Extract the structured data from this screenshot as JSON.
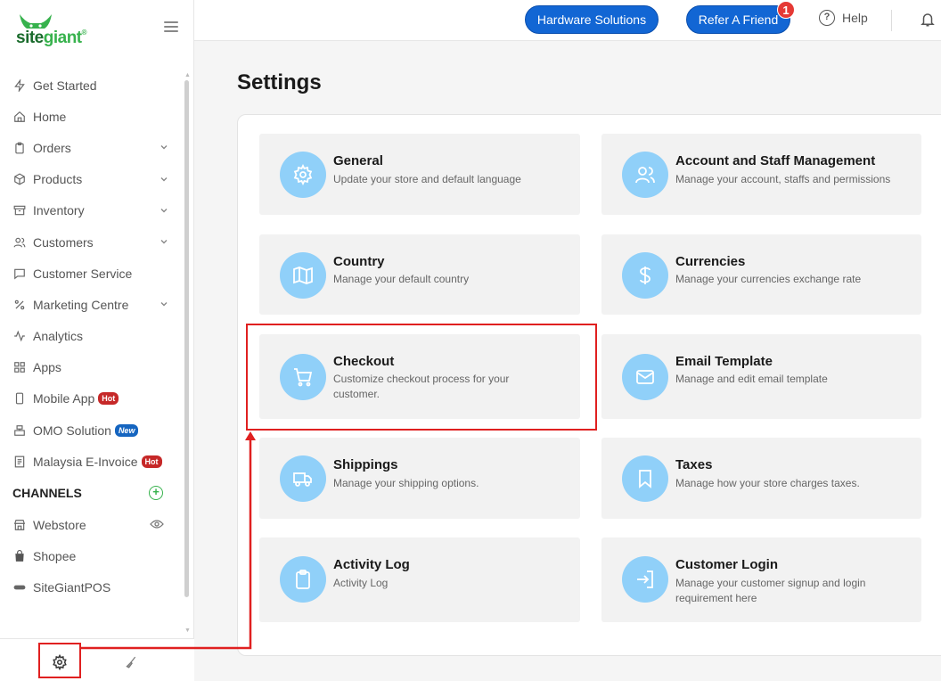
{
  "app": {
    "logo_part1": "site",
    "logo_part2": "giant",
    "logo_suffix": "®"
  },
  "sidebar": {
    "items": [
      {
        "label": "Get Started",
        "icon": "bolt-icon",
        "has_children": false
      },
      {
        "label": "Home",
        "icon": "home-icon",
        "has_children": false
      },
      {
        "label": "Orders",
        "icon": "clipboard-icon",
        "has_children": true
      },
      {
        "label": "Products",
        "icon": "box-icon",
        "has_children": true
      },
      {
        "label": "Inventory",
        "icon": "archive-icon",
        "has_children": true
      },
      {
        "label": "Customers",
        "icon": "users-icon",
        "has_children": true
      },
      {
        "label": "Customer Service",
        "icon": "chat-icon",
        "has_children": false
      },
      {
        "label": "Marketing Centre",
        "icon": "percent-icon",
        "has_children": true
      },
      {
        "label": "Analytics",
        "icon": "pulse-icon",
        "has_children": false
      },
      {
        "label": "Apps",
        "icon": "grid-icon",
        "has_children": false
      },
      {
        "label": "Mobile App",
        "icon": "phone-icon",
        "badge": "Hot"
      },
      {
        "label": "OMO Solution",
        "icon": "register-icon",
        "badge": "New"
      },
      {
        "label": "Malaysia E-Invoice",
        "icon": "invoice-icon",
        "badge": "Hot"
      }
    ],
    "channels_heading": "CHANNELS",
    "channels": [
      {
        "label": "Webstore",
        "icon": "store-icon"
      },
      {
        "label": "Shopee",
        "icon": "shopee-bag-icon"
      },
      {
        "label": "SiteGiantPOS",
        "icon": "pos-icon"
      }
    ]
  },
  "header": {
    "hardware_label": "Hardware Solutions",
    "refer_label": "Refer A Friend",
    "notification_count": "1",
    "help_label": "Help"
  },
  "main": {
    "title": "Settings",
    "cards": [
      {
        "title": "General",
        "desc": "Update your store and default language",
        "icon": "gear-icon"
      },
      {
        "title": "Account and Staff Management",
        "desc": "Manage your account, staffs and permissions",
        "icon": "users-icon"
      },
      {
        "title": "Country",
        "desc": "Manage your default country",
        "icon": "map-icon"
      },
      {
        "title": "Currencies",
        "desc": "Manage your currencies exchange rate",
        "icon": "dollar-icon"
      },
      {
        "title": "Checkout",
        "desc": "Customize checkout process for your customer.",
        "icon": "cart-icon"
      },
      {
        "title": "Email Template",
        "desc": "Manage and edit email template",
        "icon": "mail-icon"
      },
      {
        "title": "Shippings",
        "desc": "Manage your shipping options.",
        "icon": "truck-icon"
      },
      {
        "title": "Taxes",
        "desc": "Manage how your store charges taxes.",
        "icon": "bookmark-icon"
      },
      {
        "title": "Activity Log",
        "desc": "Activity Log",
        "icon": "clipboard-icon"
      },
      {
        "title": "Customer Login",
        "desc": "Manage your customer signup and login requirement here",
        "icon": "login-icon"
      }
    ]
  },
  "colors": {
    "primary": "#1266d4",
    "icon_circle": "#90d0f9",
    "highlight": "#e02020",
    "brand_green": "#37b24d"
  }
}
